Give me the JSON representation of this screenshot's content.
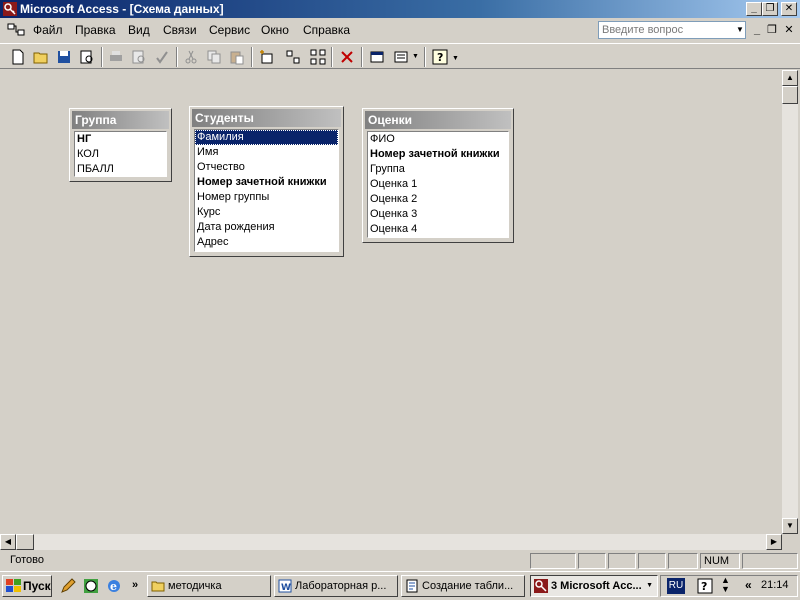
{
  "window": {
    "title": "Microsoft Access - [Схема данных]",
    "controls": [
      "_",
      "❐",
      "✕"
    ]
  },
  "menu": {
    "items": [
      "Файл",
      "Правка",
      "Вид",
      "Связи",
      "Сервис",
      "Окно",
      "Справка"
    ],
    "ask_placeholder": "Введите вопрос",
    "mdi_controls": [
      "_",
      "❐",
      "✕"
    ]
  },
  "tables": [
    {
      "name": "Группа",
      "fields": [
        {
          "label": "НГ",
          "key": true
        },
        {
          "label": "КОЛ",
          "key": false
        },
        {
          "label": "ПБАЛЛ",
          "key": false
        }
      ]
    },
    {
      "name": "Студенты",
      "fields": [
        {
          "label": "Фамилия",
          "key": false,
          "selected": true
        },
        {
          "label": "Имя",
          "key": false
        },
        {
          "label": "Отчество",
          "key": false
        },
        {
          "label": "Номер зачетной книжки",
          "key": true
        },
        {
          "label": "Номер группы",
          "key": false
        },
        {
          "label": "Курс",
          "key": false
        },
        {
          "label": "Дата рождения",
          "key": false
        },
        {
          "label": "Адрес",
          "key": false
        }
      ]
    },
    {
      "name": "Оценки",
      "fields": [
        {
          "label": "ФИО",
          "key": false
        },
        {
          "label": "Номер зачетной книжки",
          "key": true
        },
        {
          "label": "Группа",
          "key": false
        },
        {
          "label": "Оценка 1",
          "key": false
        },
        {
          "label": "Оценка 2",
          "key": false
        },
        {
          "label": "Оценка 3",
          "key": false
        },
        {
          "label": "Оценка 4",
          "key": false
        }
      ]
    }
  ],
  "statusbar": {
    "text": "Готово",
    "num": "NUM"
  },
  "taskbar": {
    "start": "Пуск",
    "buttons": [
      {
        "label": "методичка",
        "icon": "folder-icon",
        "active": false
      },
      {
        "label": "Лабораторная р...",
        "icon": "word-icon",
        "active": false
      },
      {
        "label": "Создание табли...",
        "icon": "document-icon",
        "active": false
      },
      {
        "label": "3 Microsoft Acc...",
        "icon": "access-icon",
        "active": true
      }
    ],
    "lang": "RU",
    "clock": "21:14"
  },
  "colors": {
    "titlebar": "#0a246a",
    "selection": "#0a246a",
    "face": "#d4d0c8"
  }
}
